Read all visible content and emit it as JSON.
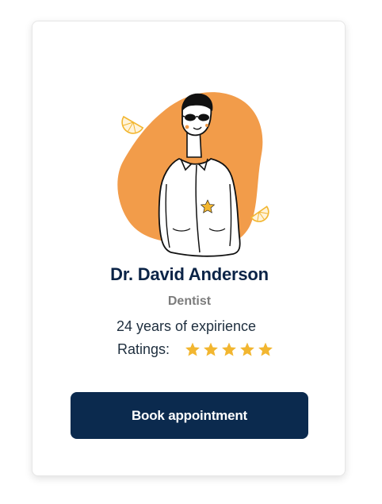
{
  "doctor": {
    "name": "Dr. David Anderson",
    "specialty": "Dentist",
    "experience": "24 years of expirience",
    "ratings_label": "Ratings:",
    "rating_value": 5,
    "rating_max": 5
  },
  "actions": {
    "book_label": "Book appointment"
  },
  "icons": {
    "star": "star-icon",
    "orange_slice": "orange-slice-icon"
  },
  "colors": {
    "accent_orange": "#f29c4a",
    "star_gold": "#f2b630",
    "navy": "#0b2a4e",
    "name_text": "#0b2447",
    "specialty_text": "#7c7c7c"
  }
}
